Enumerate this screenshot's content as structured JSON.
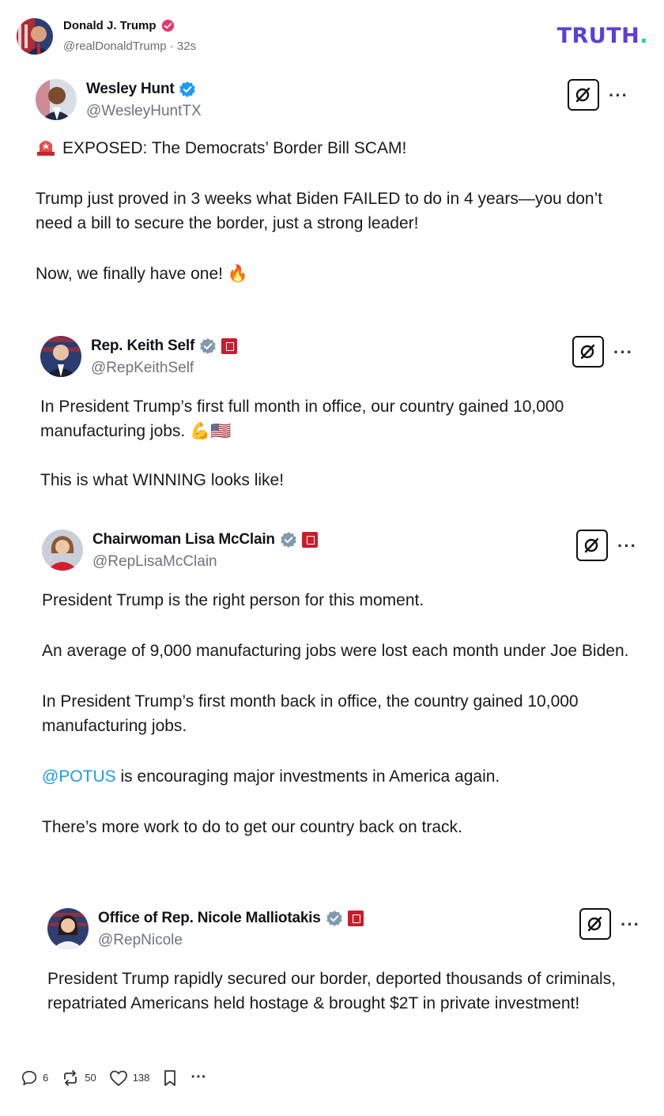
{
  "header": {
    "author_name": "Donald J. Trump",
    "author_handle": "@realDonaldTrump",
    "time": "32s",
    "brand_text": "TRUTH",
    "brand_dot": "."
  },
  "posts": [
    {
      "name": "Wesley Hunt",
      "handle": "@WesleyHuntTX",
      "badge": "blue-check",
      "paragraphs": [
        "EXPOSED: The Democrats’ Border Bill SCAM!",
        "Trump just proved in 3 weeks what Biden FAILED to do in 4 years—you don’t need a bill to secure the border, just a strong leader!",
        "Now, we finally have one! 🔥"
      ]
    },
    {
      "name": "Rep. Keith Self",
      "handle": "@RepKeithSelf",
      "badge": "gray-check",
      "paragraphs": [
        "In President Trump’s first full month in office, our country gained 10,000 manufacturing jobs. 💪🇺🇸",
        "This is what WINNING looks like!"
      ]
    },
    {
      "name": "Chairwoman Lisa McClain",
      "handle": "@RepLisaMcClain",
      "badge": "gray-check",
      "paragraphs": [
        "President Trump is the right person for this moment.",
        "An average of 9,000 manufacturing jobs were lost each month under Joe Biden.",
        "In President Trump’s first month back in office, the country gained 10,000 manufacturing jobs.",
        "is encouraging major investments in America again.",
        "There’s more work to do to get our country back on track."
      ],
      "mention": "@POTUS"
    },
    {
      "name": "Office of Rep. Nicole Malliotakis",
      "handle": "@RepNicole",
      "badge": "gray-check",
      "paragraphs": [
        "President Trump rapidly secured our border, deported thousands of criminals, repatriated Americans held hostage & brought $2T in private investment!"
      ]
    }
  ],
  "more_label": "···",
  "actions": {
    "replies": "6",
    "retruths": "50",
    "likes": "138",
    "more": "···"
  },
  "colors": {
    "brand": "#5b3fd9",
    "brand_dot": "#19d6b0",
    "verified_blue": "#1d9bf0",
    "verified_gray": "#829aab",
    "mention": "#1d9bf0",
    "pink_badge": "#e5396f"
  }
}
